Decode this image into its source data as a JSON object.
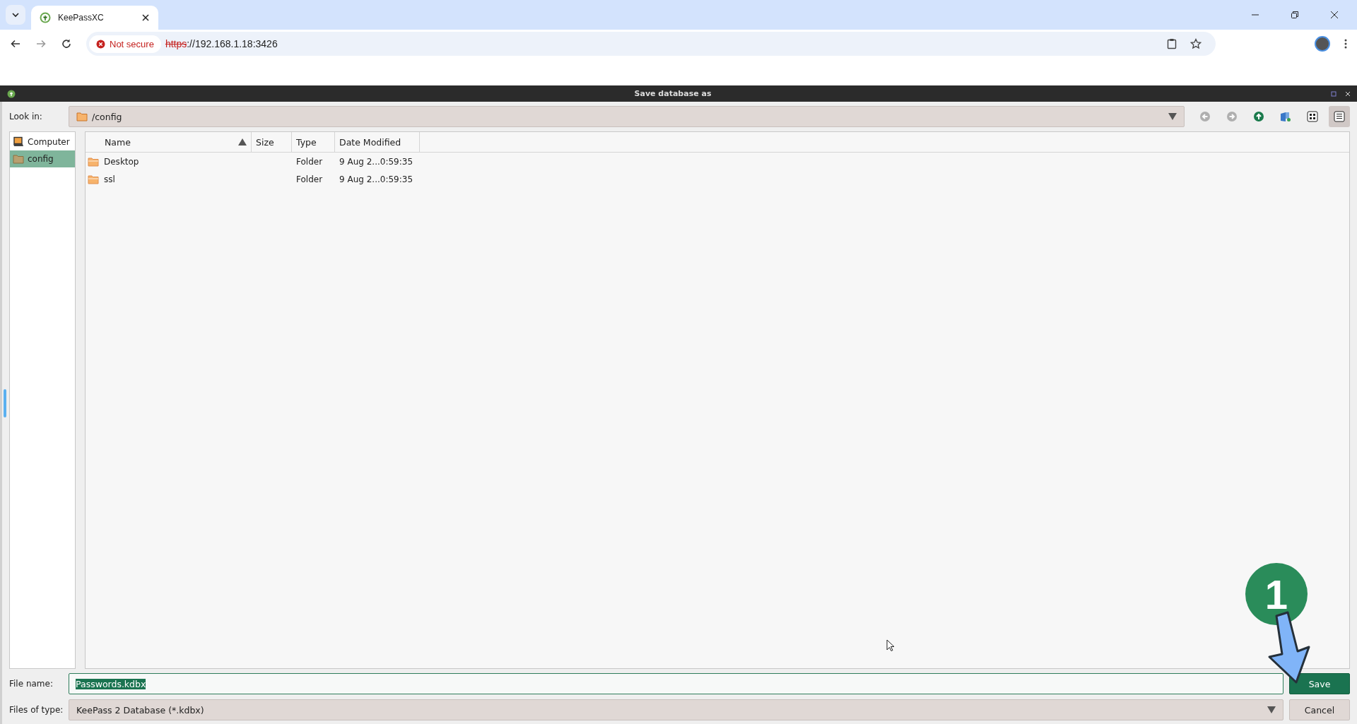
{
  "browser": {
    "tabs": [
      {
        "title": "KeePassXC",
        "selected": true
      }
    ],
    "security_label": "Not secure",
    "url_scheme": "https",
    "url_rest": "://192.168.1.18:3426"
  },
  "dialog": {
    "title": "Save database as",
    "look_in": {
      "label": "Look in:",
      "path": "/config"
    },
    "toolbar": [
      {
        "kind": "back",
        "disabled": true,
        "selected": false
      },
      {
        "kind": "forward",
        "disabled": true,
        "selected": false
      },
      {
        "kind": "up",
        "disabled": false,
        "selected": false
      },
      {
        "kind": "new-folder",
        "disabled": false,
        "selected": false
      },
      {
        "kind": "list-view",
        "disabled": false,
        "selected": false
      },
      {
        "kind": "detail-view",
        "disabled": false,
        "selected": true
      }
    ],
    "sidebar": [
      {
        "label": "Computer",
        "kind": "computer",
        "selected": false
      },
      {
        "label": "config",
        "kind": "folder",
        "selected": true
      }
    ],
    "columns": [
      {
        "label": "Name",
        "sorted": true
      },
      {
        "label": "Size",
        "sorted": false
      },
      {
        "label": "Type",
        "sorted": false
      },
      {
        "label": "Date Modified",
        "sorted": false
      }
    ],
    "rows": [
      {
        "name": "Desktop",
        "size": "",
        "type": "Folder",
        "date": "9 Aug 2...0:59:35"
      },
      {
        "name": "ssl",
        "size": "",
        "type": "Folder",
        "date": "9 Aug 2...0:59:35"
      }
    ],
    "file_name": {
      "label": "File name:",
      "value": "Passwords.kdbx",
      "text_selected": true
    },
    "file_type": {
      "label": "Files of type:",
      "value": "KeePass 2 Database (*.kdbx)"
    },
    "buttons": [
      {
        "label": "Save",
        "kind": "primary"
      },
      {
        "label": "Cancel",
        "kind": "normal"
      }
    ]
  },
  "annotation": {
    "number": "1"
  }
}
